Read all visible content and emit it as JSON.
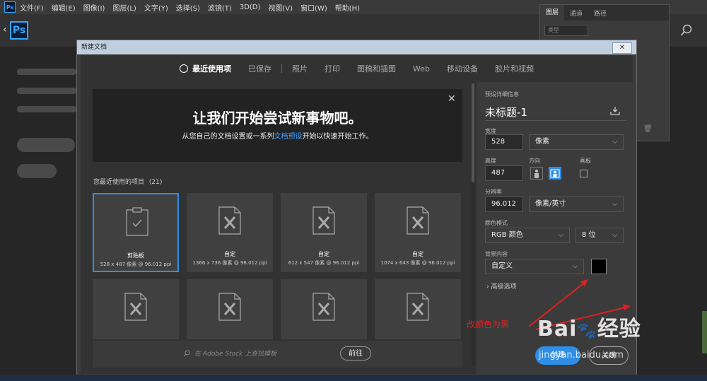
{
  "menubar": {
    "items": [
      "文件(F)",
      "编辑(E)",
      "图像(I)",
      "图层(L)",
      "文字(Y)",
      "选择(S)",
      "滤镜(T)",
      "3D(D)",
      "视图(V)",
      "窗口(W)",
      "帮助(H)"
    ],
    "app_icon": "Ps"
  },
  "home": {
    "logo": "Ps"
  },
  "layers_panel": {
    "tabs": [
      "图层",
      "通道",
      "路径"
    ],
    "filter_placeholder": "类型"
  },
  "dialog": {
    "title": "新建文档",
    "close_glyph": "✕",
    "tabs": [
      {
        "label": "最近使用项",
        "active": true
      },
      {
        "label": "已保存",
        "active": false
      },
      {
        "label": "照片",
        "active": false
      },
      {
        "label": "打印",
        "active": false
      },
      {
        "label": "图稿和插图",
        "active": false
      },
      {
        "label": "Web",
        "active": false
      },
      {
        "label": "移动设备",
        "active": false
      },
      {
        "label": "胶片和视频",
        "active": false
      }
    ],
    "hero": {
      "title": "让我们开始尝试新事物吧。",
      "sub_before": "从您自己的文档设置或一系列",
      "sub_link": "文档预设",
      "sub_after": "开始以快速开始工作。"
    },
    "recent_label": "您最近使用的项目",
    "recent_count": "(21)",
    "recent_items": [
      {
        "name": "剪贴板",
        "meta": "528 x 487 像素 @ 96.012 ppi",
        "selected": true
      },
      {
        "name": "自定",
        "meta": "1366 x 736 像素 @ 96.012 ppi",
        "selected": false
      },
      {
        "name": "自定",
        "meta": "612 x 547 像素 @ 96.012 ppi",
        "selected": false
      },
      {
        "name": "自定",
        "meta": "1074 x 643 像素 @ 96.012 ppi",
        "selected": false
      },
      {
        "name": "",
        "meta": "",
        "selected": false
      },
      {
        "name": "",
        "meta": "",
        "selected": false
      },
      {
        "name": "",
        "meta": "",
        "selected": false
      },
      {
        "name": "",
        "meta": "",
        "selected": false
      }
    ],
    "stock": {
      "placeholder": "在 Adobe Stock 上查找模板",
      "go_label": "前往"
    },
    "details": {
      "heading": "预设详细信息",
      "doc_name": "未标题-1",
      "width_label": "宽度",
      "width_value": "528",
      "width_unit": "像素",
      "height_label": "高度",
      "height_value": "487",
      "orientation_label": "方向",
      "artboard_label": "画板",
      "resolution_label": "分辨率",
      "resolution_value": "96.012",
      "resolution_unit": "像素/英寸",
      "color_mode_label": "颜色模式",
      "color_mode_value": "RGB 颜色",
      "bit_depth": "8 位",
      "background_label": "背景内容",
      "background_value": "自定义",
      "background_color": "#000000",
      "advanced_label": "高级选项",
      "create_label": "创建",
      "close_label": "关闭"
    }
  },
  "annotation": {
    "text": "改颜色为黑",
    "color": "#e02020"
  },
  "watermark": {
    "brand": "Bai",
    "brand_rest": "经验",
    "url": "jingyan.baidu.com"
  },
  "colors": {
    "accent": "#2f8ee8",
    "link": "#4aa3ff"
  }
}
